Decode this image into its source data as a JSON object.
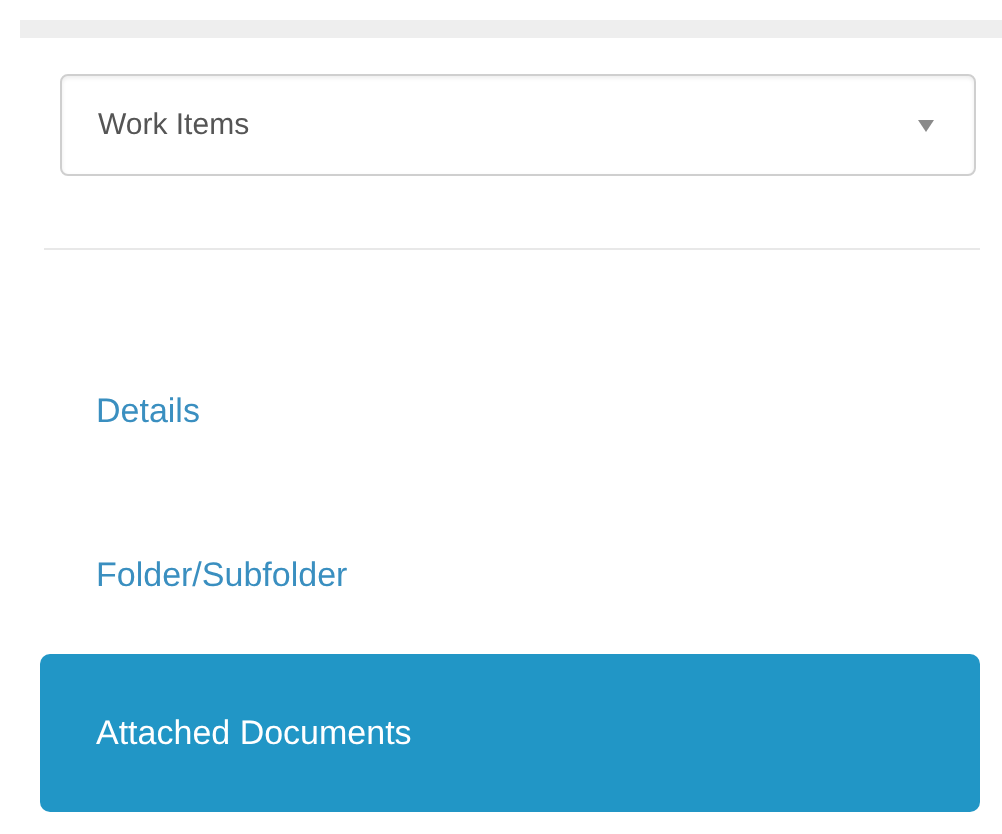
{
  "module_select": {
    "value": "Work Items"
  },
  "nav": [
    {
      "label": "Details",
      "selected": false
    },
    {
      "label": "Folder/Subfolder",
      "selected": false
    },
    {
      "label": "Attached Documents",
      "selected": true
    }
  ]
}
